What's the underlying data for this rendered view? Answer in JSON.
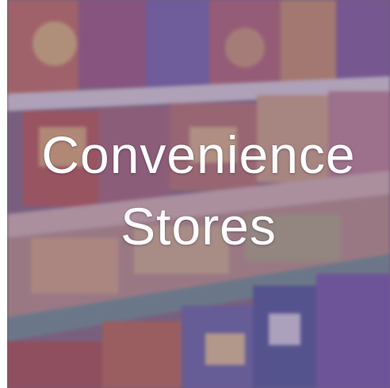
{
  "tile": {
    "title_line_1": "Convenience",
    "title_line_2": "Stores",
    "overlay_color": "#78608c",
    "photo_subject": "store-shelves-with-snack-packages"
  }
}
